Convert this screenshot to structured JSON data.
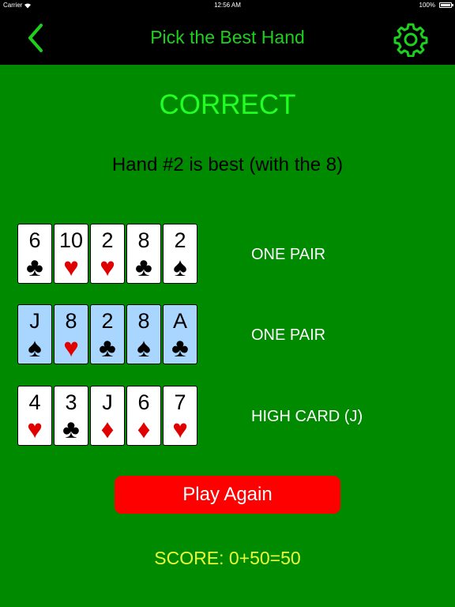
{
  "status_bar": {
    "carrier": "Carrier",
    "time": "12:56 AM",
    "battery": "100%"
  },
  "nav": {
    "title": "Pick the Best Hand",
    "back_icon": "chevron-left-icon",
    "settings_icon": "gear-icon"
  },
  "result": {
    "title": "CORRECT",
    "message": "Hand #2 is best (with the 8)"
  },
  "hands": [
    {
      "label": "ONE PAIR",
      "selected": false,
      "cards": [
        {
          "rank": "6",
          "suit": "♣",
          "color": "black"
        },
        {
          "rank": "10",
          "suit": "♥",
          "color": "red"
        },
        {
          "rank": "2",
          "suit": "♥",
          "color": "red"
        },
        {
          "rank": "8",
          "suit": "♣",
          "color": "black"
        },
        {
          "rank": "2",
          "suit": "♠",
          "color": "black"
        }
      ]
    },
    {
      "label": "ONE PAIR",
      "selected": true,
      "cards": [
        {
          "rank": "J",
          "suit": "♠",
          "color": "black"
        },
        {
          "rank": "8",
          "suit": "♥",
          "color": "red"
        },
        {
          "rank": "2",
          "suit": "♣",
          "color": "black"
        },
        {
          "rank": "8",
          "suit": "♠",
          "color": "black"
        },
        {
          "rank": "A",
          "suit": "♣",
          "color": "black"
        }
      ]
    },
    {
      "label": "HIGH CARD (J)",
      "selected": false,
      "cards": [
        {
          "rank": "4",
          "suit": "♥",
          "color": "red"
        },
        {
          "rank": "3",
          "suit": "♣",
          "color": "black"
        },
        {
          "rank": "J",
          "suit": "♦",
          "color": "red"
        },
        {
          "rank": "6",
          "suit": "♦",
          "color": "red"
        },
        {
          "rank": "7",
          "suit": "♥",
          "color": "red"
        }
      ]
    }
  ],
  "play_again_label": "Play Again",
  "score": "SCORE: 0+50=50",
  "colors": {
    "background": "#008a00",
    "nav_title": "#1ed01e",
    "result_title": "#22ff22",
    "selected_card": "#a8d6ff",
    "button": "#ff0000",
    "score": "#e8ff3a"
  }
}
